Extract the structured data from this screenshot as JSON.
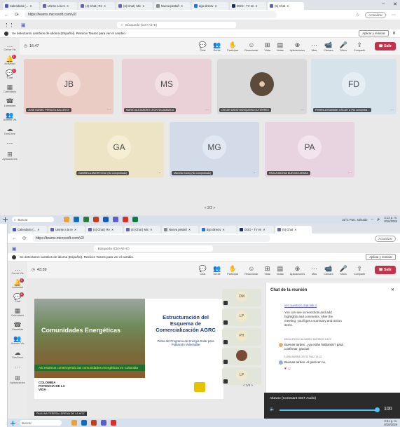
{
  "screen1": {
    "tabs": [
      {
        "label": "Calendario (...",
        "color": "#4b53bc",
        "active": false
      },
      {
        "label": "Unirse a la re",
        "color": "#6264a7",
        "active": false
      },
      {
        "label": "(4) Chat | Re",
        "color": "#6264a7",
        "active": false
      },
      {
        "label": "(4) Chat | Mic",
        "color": "#6264a7",
        "active": false
      },
      {
        "label": "Nueva pestañ",
        "color": "#888888",
        "active": false
      },
      {
        "label": "dgo directv",
        "color": "#1a73e8",
        "active": false
      },
      {
        "label": "DGO - TV en",
        "color": "#1e2b5c",
        "active": false
      },
      {
        "label": "(5) Chat",
        "color": "#6264a7",
        "active": true
      }
    ],
    "url": "https://teams.microsoft.com/v2/",
    "update_label": "Actualizar",
    "search_placeholder": "Búsqueda (Ctrl+Alt+E)",
    "notice_text": "Se detectaron cambios de idioma (Español). Reinicie Teams para ver el cambio.",
    "apply_label": "Aplicar y reiniciar",
    "rail": [
      {
        "label": "Cerrar Vis",
        "glyph": "…",
        "badge": ""
      },
      {
        "label": "Actividad",
        "glyph": "🔔",
        "badge": "1"
      },
      {
        "label": "Chat",
        "glyph": "💬",
        "badge": "5"
      },
      {
        "label": "Calendario",
        "glyph": "▦",
        "badge": ""
      },
      {
        "label": "Llamadas",
        "glyph": "☎",
        "badge": ""
      },
      {
        "label": "Aviento Vis",
        "glyph": "👥",
        "badge": ""
      },
      {
        "label": "OneDrive",
        "glyph": "☁",
        "badge": ""
      },
      {
        "label": "",
        "glyph": "⋯",
        "badge": ""
      },
      {
        "label": "Aplicaciones",
        "glyph": "⊞",
        "badge": ""
      }
    ],
    "timer": "16:47",
    "controls": [
      "Chat",
      "Gente",
      "Participar",
      "Reaccionar",
      "Vista",
      "Notas",
      "Aplicaciones",
      "Más",
      "Cámara",
      "Micro",
      "Compartir"
    ],
    "leave_label": "Salir",
    "tiles": [
      {
        "initials": "JB",
        "name": "JOSE DANIEL PERALTA BALLESTA",
        "bg": "#eaccc4",
        "avatar": "#f3dcd5"
      },
      {
        "initials": "MS",
        "name": "MARIO ALEJANDRO LEON SALAMANCA",
        "bg": "#ead1d8",
        "avatar": "#f3e0e5"
      },
      {
        "initials": "",
        "name": "OSCAR DAVID MOSQUERA GUTIERREZ",
        "bg": "#d9d9d9",
        "avatar": "#5c4a3b"
      },
      {
        "initials": "FD",
        "name": "Fireflies.ai Notetaker OSCAR D (No comproba...",
        "bg": "#d6e3ea",
        "avatar": "#e4eef3"
      },
      {
        "initials": "GA",
        "name": "GABRIELA AMORTEGUI (No comprobado)",
        "bg": "#ece4c4",
        "avatar": "#f5eed5"
      },
      {
        "initials": "MG",
        "name": "Marcela Godoy (No comprobado)",
        "bg": "#d3dbe9",
        "avatar": "#e1e8f3"
      },
      {
        "initials": "PA",
        "name": "PAOLA MILENA BUELVAS ARARA",
        "bg": "#e8d4e0",
        "avatar": "#f2e3ec"
      }
    ],
    "pager": "< 2/2 >",
    "taskbar_search": "Buscar",
    "weather": "33°C  Parc. soleado",
    "time": "3:13 p. m.",
    "date": "8/16/2025"
  },
  "screen2": {
    "timer": "43:39",
    "slide_title": "Estructuración del Esquema de Comercialización AGRC",
    "slide_subtitle": "Piloto del Programa de Energía Solar para Población Vulnerable",
    "image_title": "Comunidades Energéticas",
    "banner": "Así estamos construyendo las comunidades energéticas en Colombia",
    "logo_text": "COLOMBIA POTENCIA DE LA VIDA",
    "presenter": "PAULINA TERESA LERENA DE LA HOZ",
    "side_tiles": [
      "DM",
      "LP",
      "PH",
      "",
      "LP"
    ],
    "side_pager": "< 1/4 >",
    "chat_title": "Chat de la reunión",
    "chat_link": "ver nuestros chat link 1",
    "bot_message": "You can see screenshots and add highlights and comments. After the meeting, you'll get a summary and action items.",
    "msg1_author": "DELIA ROCIO ALVAREZ MORENO  14:22",
    "msg1_text": "Buenas tardes, ¿ya están hablando? para confirmar, gracias",
    "msg2_author": "LUISA MARIA ORTIZ RUIZ  14:22",
    "msg2_text": "Buenas tardes. Al parecer no.",
    "audio_title": "Altavoz (Conexant ISST Audio)",
    "volume": "100",
    "time": "3:41 p. m.",
    "date": "8/16/2025"
  }
}
